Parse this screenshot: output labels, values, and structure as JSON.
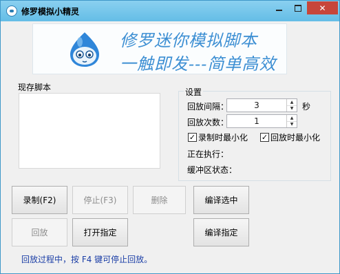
{
  "window": {
    "title": "修罗模拟小精灵",
    "minimize_icon": "minimize-icon",
    "maximize_icon": "maximize-icon",
    "close_glyph": "✕"
  },
  "banner": {
    "line1": "修罗迷你模拟脚本",
    "line2": "一触即发---简单高效"
  },
  "scripts": {
    "label": "现存脚本",
    "items": []
  },
  "settings": {
    "title": "设置",
    "interval_label": "回放间隔：",
    "interval_value": "3",
    "interval_unit": "秒",
    "count_label": "回放次数：",
    "count_value": "1",
    "record_minimize": {
      "label": "录制时最小化",
      "checked": true
    },
    "playback_minimize": {
      "label": "回放时最小化",
      "checked": true
    },
    "running_label": "正在执行：",
    "buffer_label": "缓冲区状态："
  },
  "buttons": {
    "record": "录制(F2)",
    "stop": "停止(F3)",
    "delete": "删除",
    "compile_selected": "编译选中",
    "playback": "回放",
    "open_specified": "打开指定",
    "compile_specified": "编译指定"
  },
  "status": {
    "hint": "回放过程中，按 F4 键可停止回放。"
  },
  "colors": {
    "titlebar": "#6dc1e9",
    "banner_text": "#3d8fd3",
    "hint_text": "#1b3ea6",
    "close_button": "#c7463a"
  }
}
